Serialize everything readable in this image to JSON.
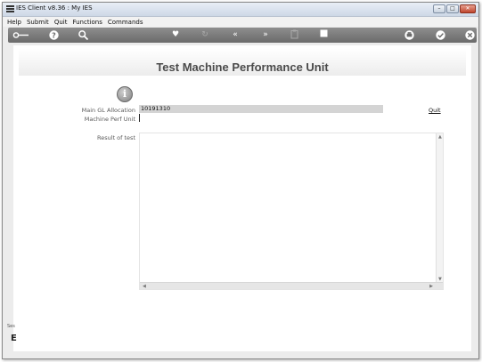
{
  "window": {
    "title": "IES Client v8.36 : My IES"
  },
  "menu": [
    "Help",
    "Submit",
    "Quit",
    "Functions",
    "Commands"
  ],
  "toolbar": {
    "icons": [
      "key-icon",
      "help-icon",
      "search-icon",
      "heart-icon",
      "refresh-icon",
      "rewind-icon",
      "fast-forward-icon",
      "clipboard-icon",
      "stop-icon",
      "printer-icon",
      "confirm-icon",
      "close-icon"
    ]
  },
  "page": {
    "title": "Test Machine Performance Unit"
  },
  "form": {
    "gl_label": "Main GL Allocation",
    "gl_value": "10191310",
    "perf_label": "Machine Perf Unit",
    "perf_value": "",
    "result_label": "Result of test",
    "quit_label": "Quit"
  },
  "side": {
    "handle": "Ses",
    "glyph": "E"
  }
}
